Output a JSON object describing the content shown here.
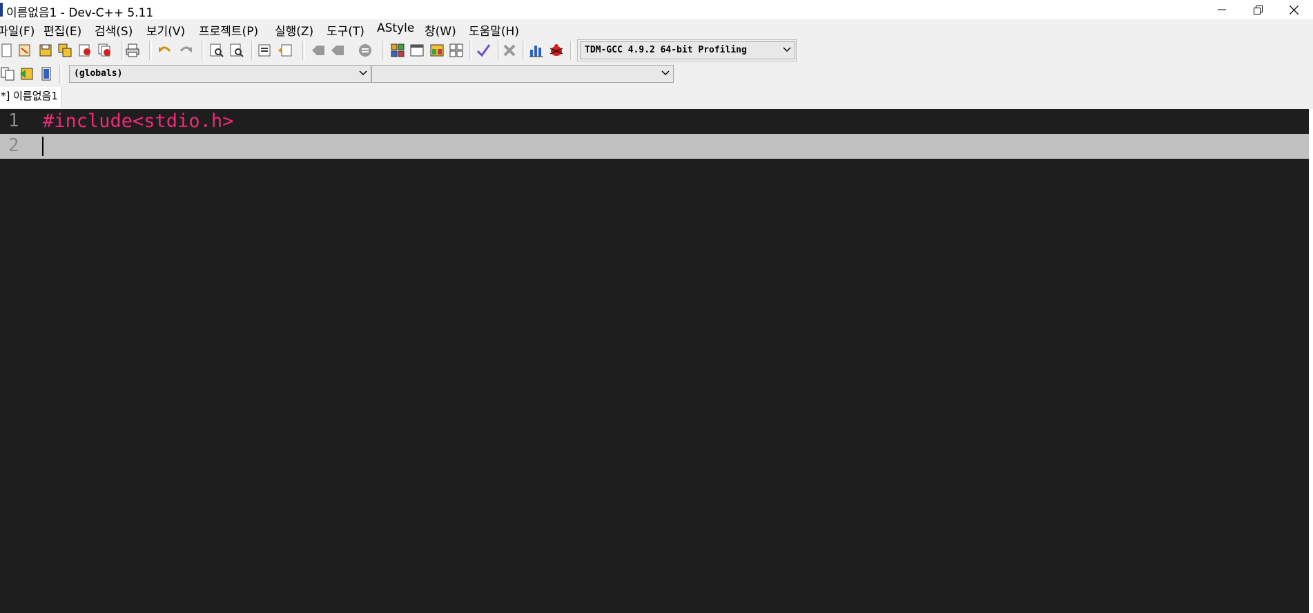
{
  "window": {
    "title": "이름없음1 - Dev-C++ 5.11"
  },
  "menu": {
    "items": [
      "파일(F)",
      "편집(E)",
      "검색(S)",
      "보기(V)",
      "프로젝트(P)",
      "실행(Z)",
      "도구(T)",
      "AStyle",
      "창(W)",
      "도움말(H)"
    ]
  },
  "toolbar": {
    "compiler": "TDM-GCC 4.9.2 64-bit Profiling",
    "icons": [
      "new-file-icon",
      "open-file-icon",
      "save-icon",
      "save-all-icon",
      "close-icon",
      "close-all-icon",
      "print-icon",
      "undo-icon",
      "redo-icon",
      "find-icon",
      "replace-icon",
      "indent-icon",
      "unindent-icon",
      "goto-back-icon",
      "goto-forward-icon",
      "bookmark-icon",
      "compile-icon",
      "run-icon",
      "compile-run-icon",
      "rebuild-icon",
      "check-icon",
      "stop-icon",
      "chart-icon",
      "debug-icon"
    ]
  },
  "toolbar2": {
    "scope": "(globals)",
    "function": ""
  },
  "tabs": [
    {
      "label": "*] 이름없음1"
    }
  ],
  "editor": {
    "lines": [
      {
        "number": "1",
        "text": "#include<stdio.h>"
      },
      {
        "number": "2",
        "text": ""
      }
    ],
    "colors": {
      "background": "#1e1e1e",
      "preprocessor": "#f0287a",
      "current_line": "#c0c0c0",
      "line_number": "#8a8a8a"
    }
  }
}
